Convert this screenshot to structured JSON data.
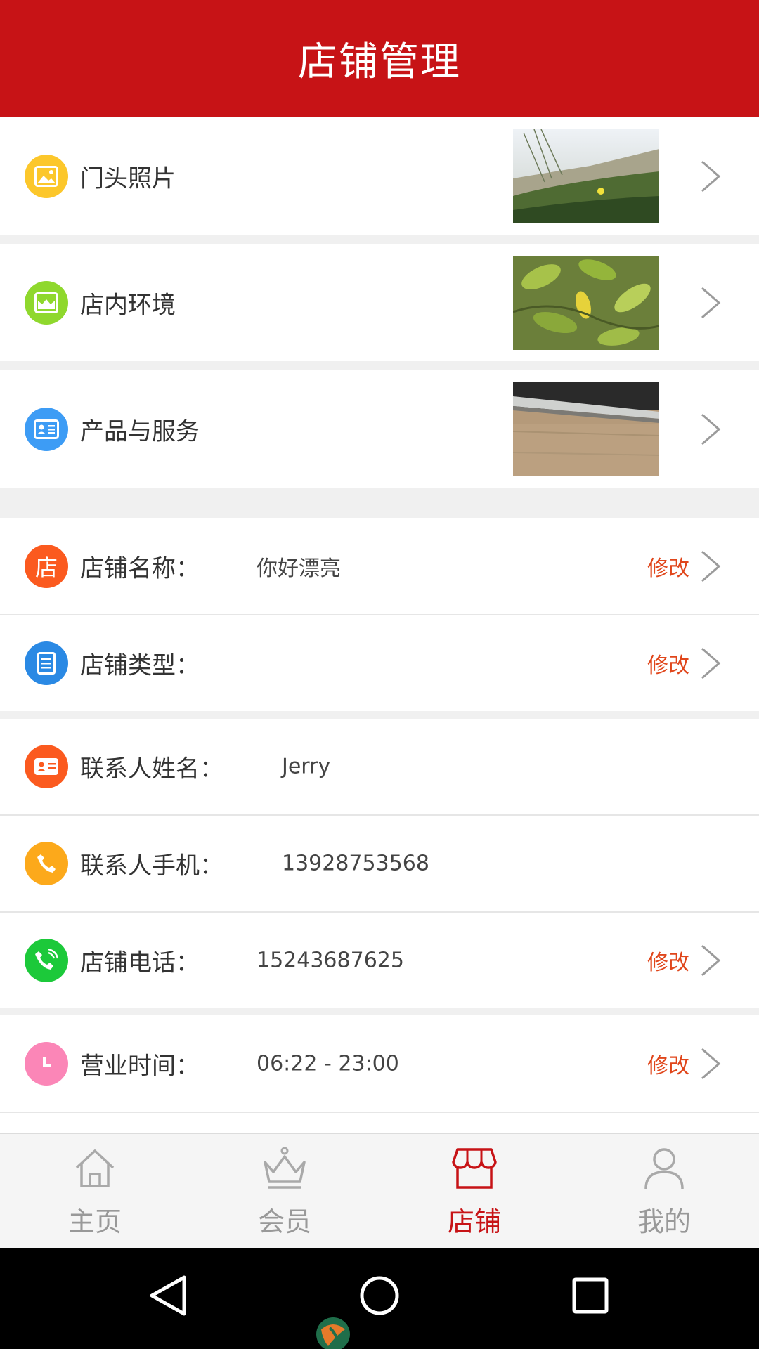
{
  "header": {
    "title": "店铺管理"
  },
  "photo_rows": [
    {
      "label": "门头照片"
    },
    {
      "label": "店内环境"
    },
    {
      "label": "产品与服务"
    }
  ],
  "info_rows": {
    "store_name": {
      "label": "店铺名称：",
      "value": "你好漂亮",
      "edit": "修改"
    },
    "store_type": {
      "label": "店铺类型：",
      "value": "",
      "edit": "修改"
    },
    "contact_name": {
      "label": "联系人姓名：",
      "value": "Jerry"
    },
    "contact_phone": {
      "label": "联系人手机：",
      "value": "13928753568"
    },
    "store_phone": {
      "label": "店铺电话：",
      "value": "15243687625",
      "edit": "修改"
    },
    "business_hours": {
      "label": "营业时间：",
      "value": "06:22 - 23:00",
      "edit": "修改"
    }
  },
  "store_icon_char": "店",
  "tabs": [
    {
      "label": "主页",
      "icon": "home-icon"
    },
    {
      "label": "会员",
      "icon": "crown-icon"
    },
    {
      "label": "店铺",
      "icon": "store-icon",
      "active": true
    },
    {
      "label": "我的",
      "icon": "person-icon"
    }
  ],
  "colors": {
    "primary": "#c71316",
    "edit": "#e0461b",
    "icon_photo": "#fcc72b",
    "icon_env": "#8fd82d",
    "icon_product": "#3d9cf5",
    "icon_store": "#fb5a1f",
    "icon_type": "#2a89e4",
    "icon_contact": "#fb5a1f",
    "icon_mobile": "#fca91b",
    "icon_phone": "#1cc93a",
    "icon_hours": "#fb86b7"
  }
}
